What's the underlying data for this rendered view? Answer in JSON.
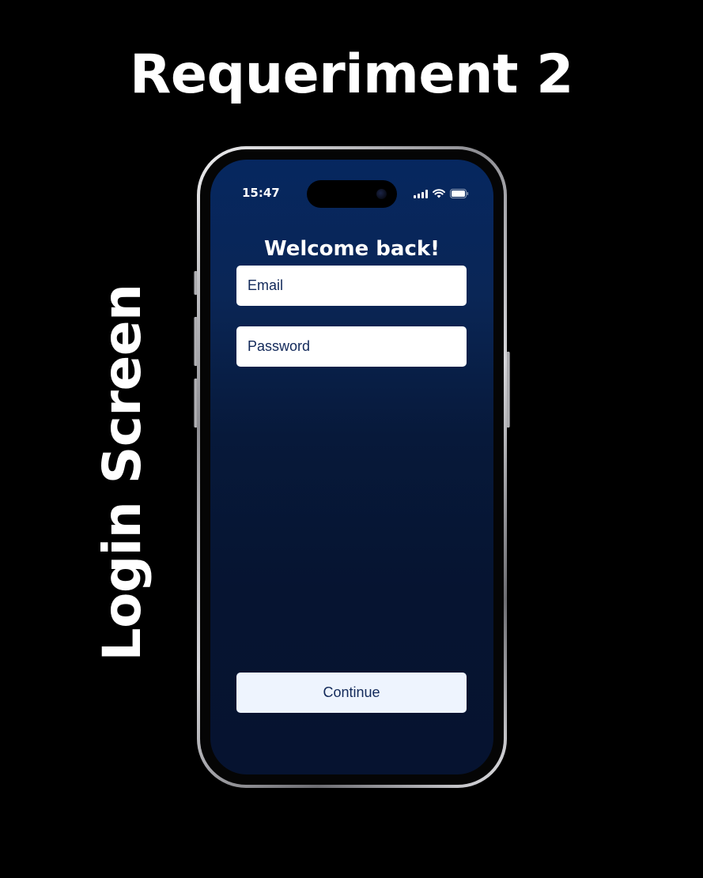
{
  "header": {
    "title": "Requeriment 2"
  },
  "side_label": {
    "text": "Login Screen"
  },
  "status_bar": {
    "time": "15:47",
    "icons": [
      "signal-icon",
      "wifi-icon",
      "battery-icon"
    ]
  },
  "login": {
    "title": "Welcome back!",
    "email_placeholder": "Email",
    "email_value": "",
    "password_placeholder": "Password",
    "password_value": "",
    "continue_label": "Continue"
  },
  "colors": {
    "page_background": "#000000",
    "screen_gradient_top": "#06275f",
    "screen_gradient_bottom": "#061330",
    "field_background": "#ffffff",
    "button_background": "#eef4fe",
    "field_text": "#12295a"
  }
}
